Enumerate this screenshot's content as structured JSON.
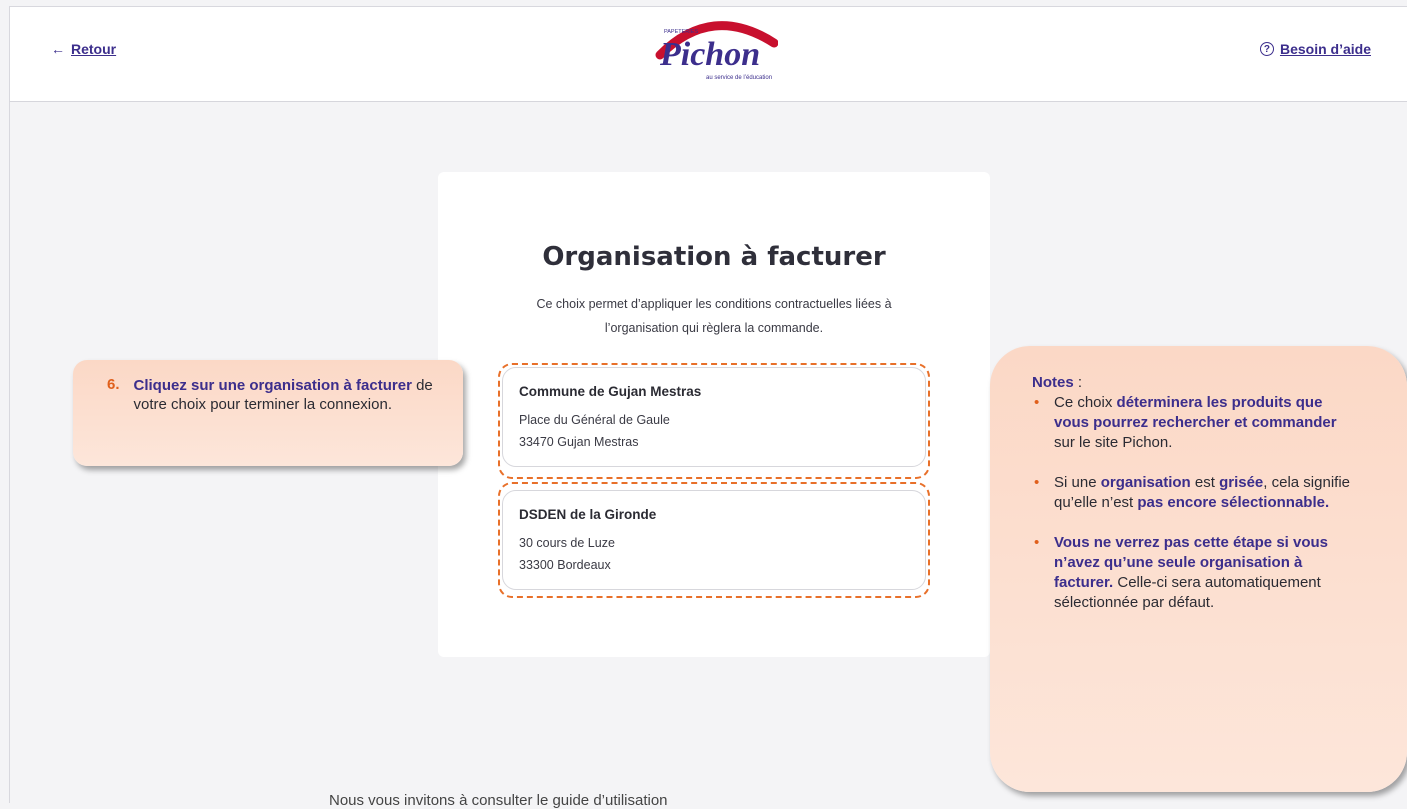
{
  "header": {
    "back_label": "Retour",
    "help_label": "Besoin d’aide",
    "logo": {
      "brand_small": "PAPETERIES",
      "brand": "Pichon",
      "tagline": "au service de l’éducation"
    }
  },
  "card": {
    "title": "Organisation à facturer",
    "subtitle": "Ce choix permet d’appliquer les conditions contractuelles liées à l’organisation qui règlera la commande.",
    "organisations": [
      {
        "name": "Commune de Gujan Mestras",
        "address1": "Place du Général de Gaule",
        "address2": "33470 Gujan Mestras"
      },
      {
        "name": "DSDEN de la Gironde",
        "address1": "30 cours de Luze",
        "address2": "33300 Bordeaux"
      }
    ]
  },
  "callout_step": {
    "number": "6.",
    "bold": "Cliquez sur une organisation à facturer",
    "rest": " de votre choix pour terminer la connexion."
  },
  "notes": {
    "head_bold": "Notes",
    "head_rest": " :",
    "items": [
      {
        "p1": "Ce choix ",
        "b1": "déterminera les produits que vous pourrez rechercher et commander",
        "p2": " sur le site Pichon."
      },
      {
        "p1": "Si une ",
        "b1": "organisation",
        "p2": " est ",
        "b2": "grisée",
        "p3": ", cela signifie qu’elle n’est ",
        "b3": "pas encore sélectionnable."
      },
      {
        "b1": "Vous ne verrez pas cette étape si vous n’avez qu’une seule organisation à facturer.",
        "p2": " Celle-ci sera automatiquement sélectionnée par défaut."
      }
    ]
  },
  "footer_text": "Nous vous invitons à consulter le guide d’utilisation",
  "colors": {
    "accent": "#3c2e8c",
    "highlight": "#e8702a",
    "brand_red": "#c8102e"
  },
  "icons": {
    "back": "arrow-left-icon",
    "help": "question-circle-icon"
  }
}
